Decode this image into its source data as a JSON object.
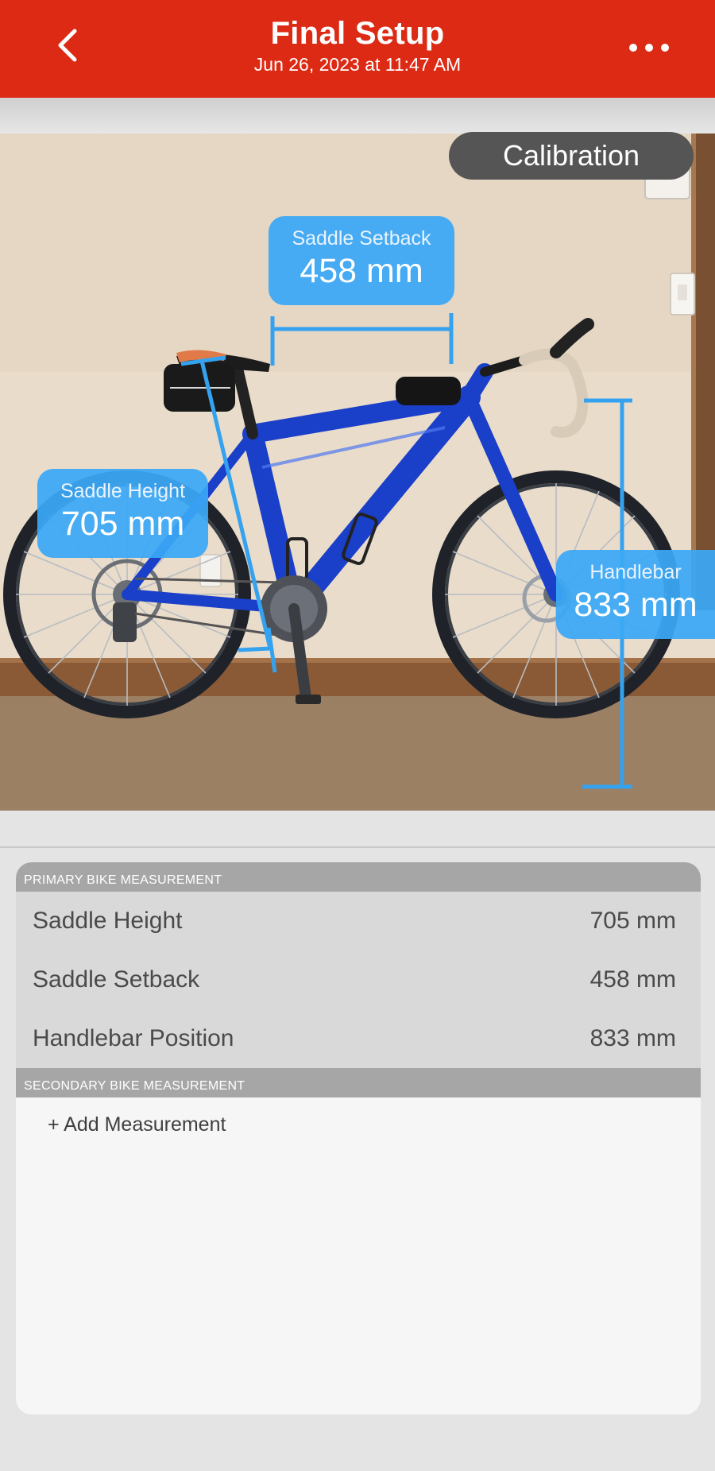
{
  "header": {
    "title": "Final Setup",
    "subtitle": "Jun 26, 2023 at 11:47 AM"
  },
  "photo": {
    "calibration_label": "Calibration",
    "labels": {
      "saddle_setback": {
        "label": "Saddle Setback",
        "value": "458 mm"
      },
      "saddle_height": {
        "label": "Saddle Height",
        "value": "705 mm"
      },
      "handlebar": {
        "label": "Handlebar",
        "value": "833 mm"
      }
    }
  },
  "primary": {
    "header": "PRIMARY BIKE MEASUREMENT",
    "rows": [
      {
        "label": "Saddle Height",
        "value": "705 mm"
      },
      {
        "label": "Saddle Setback",
        "value": "458 mm"
      },
      {
        "label": "Handlebar Position",
        "value": "833 mm"
      }
    ]
  },
  "secondary": {
    "header": "SECONDARY BIKE MEASUREMENT",
    "add_label": "+ Add Measurement"
  },
  "colors": {
    "header_bg": "#dc2a14",
    "measure_blue": "#3aa8f5",
    "frame_blue": "#1a3fc8"
  },
  "icons": {
    "back": "chevron-left-icon",
    "more": "more-horizontal-icon"
  }
}
